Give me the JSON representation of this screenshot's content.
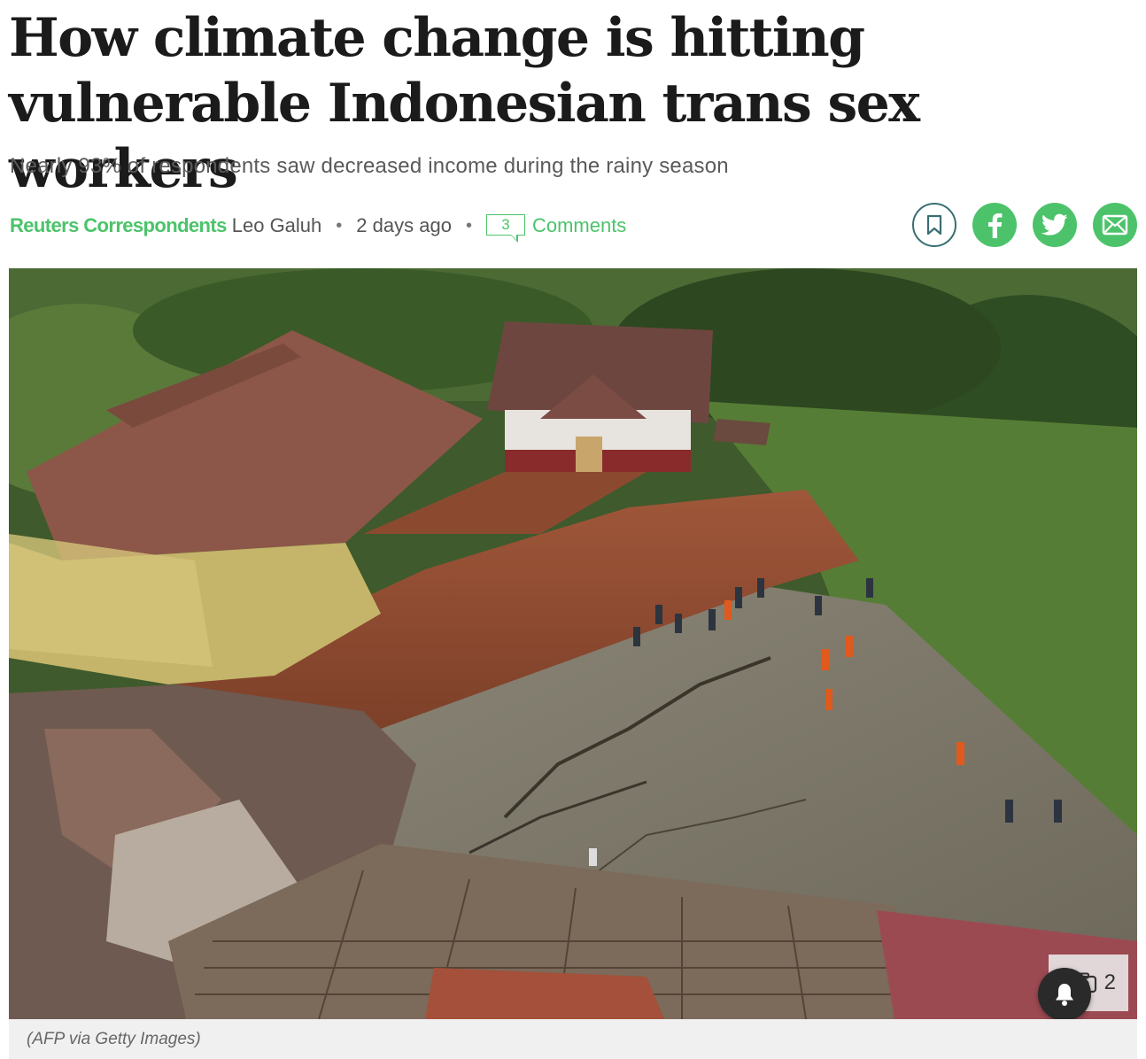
{
  "article": {
    "headline": "How climate change is hitting vulnerable Indonesian trans sex workers",
    "subheadline": "Nearly 93% of respondents saw decreased income during the rainy season"
  },
  "byline": {
    "organization": "Reuters Correspondents",
    "author": "Leo Galuh",
    "separator": "•",
    "timestamp": "2 days ago",
    "comment_count": "3",
    "comments_label": "Comments"
  },
  "share": {
    "icons": [
      "bookmark-icon",
      "facebook-icon",
      "twitter-icon",
      "email-icon"
    ],
    "colors": {
      "accent": "#4cc36a",
      "bookmark_border": "#3a6e72"
    }
  },
  "image": {
    "caption": "(AFP via Getty Images)",
    "gallery_count": "2",
    "gallery_icon": "camera-icon",
    "notification_icon": "bell-icon"
  }
}
